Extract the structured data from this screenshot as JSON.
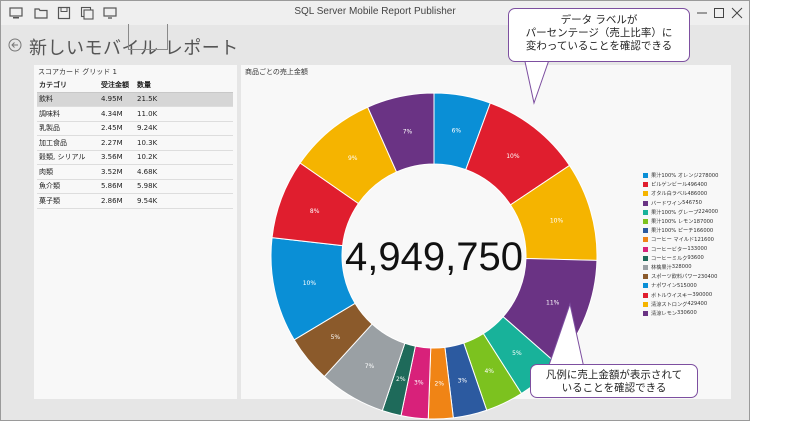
{
  "window": {
    "title": "SQL Server Mobile Report Publisher"
  },
  "page": {
    "title": "新しいモバイル レポート"
  },
  "scorecard": {
    "title": "スコアカード グリッド 1",
    "columns": [
      "カテゴリ",
      "受注金額",
      "数量"
    ],
    "rows": [
      [
        "飲料",
        "4.95M",
        "21.5K"
      ],
      [
        "調味料",
        "4.34M",
        "11.0K"
      ],
      [
        "乳製品",
        "2.45M",
        "9.24K"
      ],
      [
        "加工食品",
        "2.27M",
        "10.3K"
      ],
      [
        "穀類, シリアル",
        "3.56M",
        "10.2K"
      ],
      [
        "肉類",
        "3.52M",
        "4.68K"
      ],
      [
        "魚介類",
        "5.86M",
        "5.98K"
      ],
      [
        "菓子類",
        "2.86M",
        "9.54K"
      ]
    ],
    "selected_row": 0
  },
  "chart_panel": {
    "title": "商品ごとの売上金額"
  },
  "chart_data": {
    "type": "pie",
    "donut": true,
    "center_value": "4,949,750",
    "total": 4949750,
    "slices": [
      {
        "name": "果汁100% オレンジ",
        "value": 278000,
        "color": "#0a8fd6",
        "label": "6%"
      },
      {
        "name": "ピルゲンビール",
        "value": 496400,
        "color": "#e01e2e",
        "label": "10%"
      },
      {
        "name": "オタル白ラベル",
        "value": 486000,
        "color": "#f5b400",
        "label": "10%"
      },
      {
        "name": "バードワイン",
        "value": 546750,
        "color": "#6a3384",
        "label": "11%"
      },
      {
        "name": "果汁100% グレープ",
        "value": 224000,
        "color": "#18b29a",
        "label": "5%"
      },
      {
        "name": "果汁100% レモン",
        "value": 187000,
        "color": "#7cc21f",
        "label": "4%"
      },
      {
        "name": "果汁100% ピーチ",
        "value": 166000,
        "color": "#2c5aa0",
        "label": "3%"
      },
      {
        "name": "コーヒー マイルド",
        "value": 121600,
        "color": "#f08415",
        "label": "2%"
      },
      {
        "name": "コーヒービター",
        "value": 133000,
        "color": "#d8217a",
        "label": "3%"
      },
      {
        "name": "コーヒーミルク",
        "value": 93600,
        "color": "#1e6a5a",
        "label": "2%"
      },
      {
        "name": "林檎果汁",
        "value": 328000,
        "color": "#9aa0a4",
        "label": "7%"
      },
      {
        "name": "スポーツ飲料パワー",
        "value": 230400,
        "color": "#8b5a2b",
        "label": "5%"
      },
      {
        "name": "ナポワイン",
        "value": 515000,
        "color": "#0a8fd6",
        "label": "10%"
      },
      {
        "name": "ボトルウイスキー",
        "value": 390000,
        "color": "#e01e2e",
        "label": "8%"
      },
      {
        "name": "清涼ストロング",
        "value": 429400,
        "color": "#f5b400",
        "label": "9%"
      },
      {
        "name": "清涼レモン",
        "value": 330600,
        "color": "#6a3384",
        "label": "7%"
      }
    ],
    "legend_position": "right"
  },
  "callouts": {
    "top": [
      "データ ラベルが",
      "パーセンテージ（売上比率）に",
      "変わっていることを確認できる"
    ],
    "bottom": [
      "凡例に売上金額が表示されて",
      "いることを確認できる"
    ]
  },
  "colors": {
    "callout_border": "#7d4fa0",
    "window_bg": "#e6e6e6"
  }
}
